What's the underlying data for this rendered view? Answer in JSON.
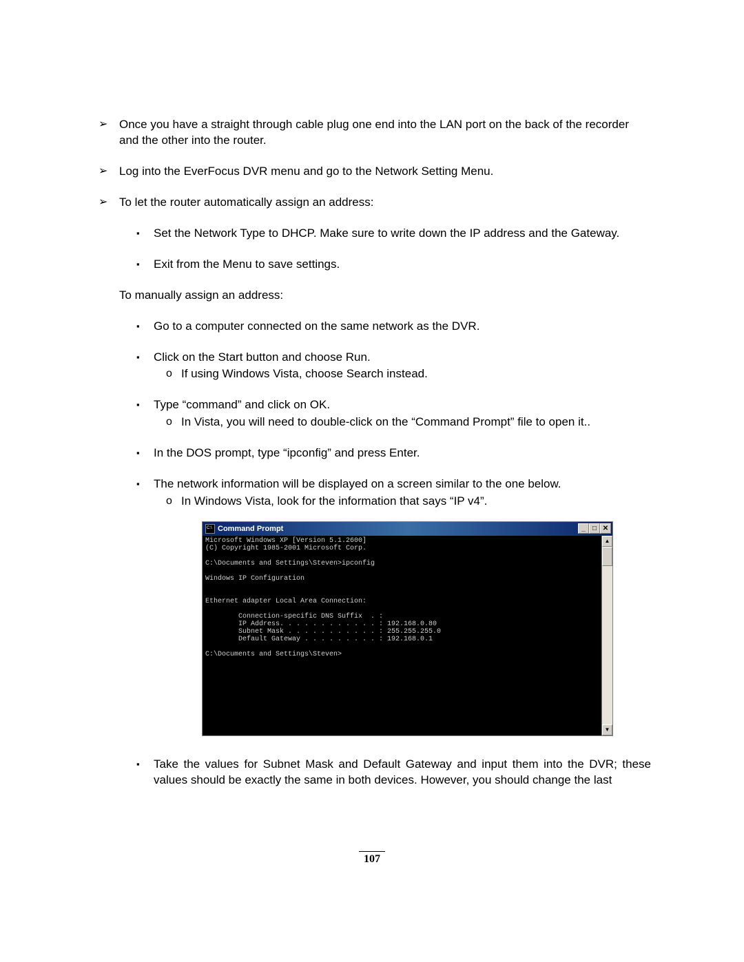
{
  "bullets_arrow": [
    "Once you have a straight through cable plug one end into the LAN port on the back of the recorder and the other into the router.",
    "Log into the EverFocus DVR menu and go to the Network Setting Menu.",
    "To let the router automatically assign an address:"
  ],
  "dhcp_steps": [
    "Set the Network Type to DHCP. Make sure to write down the IP address and the Gateway.",
    "Exit from the Menu to save settings."
  ],
  "manual_intro": "To manually assign an address:",
  "manual_steps": [
    {
      "text": "Go to a computer connected on the same network as the DVR.",
      "sub": []
    },
    {
      "text": "Click on the Start button and choose Run.",
      "sub": [
        "If using Windows Vista, choose Search instead."
      ]
    },
    {
      "text": "Type “command” and click on OK.",
      "sub": [
        "In Vista, you will need to double-click on the “Command Prompt” file to open it.."
      ]
    },
    {
      "text": "In the DOS prompt, type “ipconfig” and press Enter.",
      "sub": []
    },
    {
      "text": "The network information will be displayed on a screen similar to the one below.",
      "sub": [
        "In Windows Vista, look for the information that says “IP v4”."
      ]
    }
  ],
  "cmd": {
    "title": "Command Prompt",
    "lines": "Microsoft Windows XP [Version 5.1.2600]\n(C) Copyright 1985-2001 Microsoft Corp.\n\nC:\\Documents and Settings\\Steven>ipconfig\n\nWindows IP Configuration\n\n\nEthernet adapter Local Area Connection:\n\n        Connection-specific DNS Suffix  . :\n        IP Address. . . . . . . . . . . . : 192.168.0.80\n        Subnet Mask . . . . . . . . . . . : 255.255.255.0\n        Default Gateway . . . . . . . . . : 192.168.0.1\n\nC:\\Documents and Settings\\Steven>"
  },
  "final_para": "Take the values for Subnet Mask and Default Gateway and input them into the DVR; these values should be exactly the same in both devices. However, you should change the last",
  "btn_min": "_",
  "btn_max": "□",
  "btn_close": "✕",
  "scroll_up": "▲",
  "scroll_down": "▼",
  "page_number": "107"
}
